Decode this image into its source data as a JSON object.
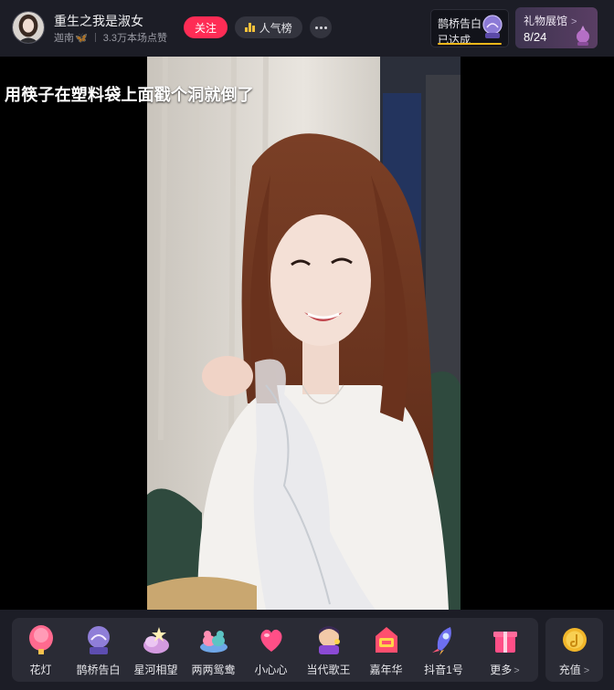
{
  "header": {
    "host_name": "重生之我是淑女",
    "host_location": "迦南",
    "likes_text": "3.3万本场点赞",
    "follow_label": "关注",
    "rank_label": "人气榜",
    "task": {
      "title": "鹊桥告白",
      "status": "已达成"
    },
    "gift_hall": {
      "title": "礼物展馆",
      "count": "8/24"
    }
  },
  "video": {
    "caption": "用筷子在塑料袋上面戳个洞就倒了"
  },
  "gifts": [
    {
      "label": "花灯",
      "icon": "lantern-icon"
    },
    {
      "label": "鹊桥告白",
      "icon": "crystal-globe-icon"
    },
    {
      "label": "星河相望",
      "icon": "star-cloud-icon"
    },
    {
      "label": "两两鸳鸯",
      "icon": "mandarin-ducks-icon"
    },
    {
      "label": "小心心",
      "icon": "heart-icon"
    },
    {
      "label": "当代歌王",
      "icon": "singer-icon"
    },
    {
      "label": "嘉年华",
      "icon": "carnival-icon"
    },
    {
      "label": "抖音1号",
      "icon": "rocket-icon"
    },
    {
      "label": "更多",
      "icon": "gift-box-icon"
    }
  ],
  "recharge_label": "充值",
  "colors": {
    "accent_red": "#fe2c55",
    "panel_bg": "#1c1d26",
    "tile_bg": "#2a2b35",
    "gold": "#f5b81a"
  }
}
